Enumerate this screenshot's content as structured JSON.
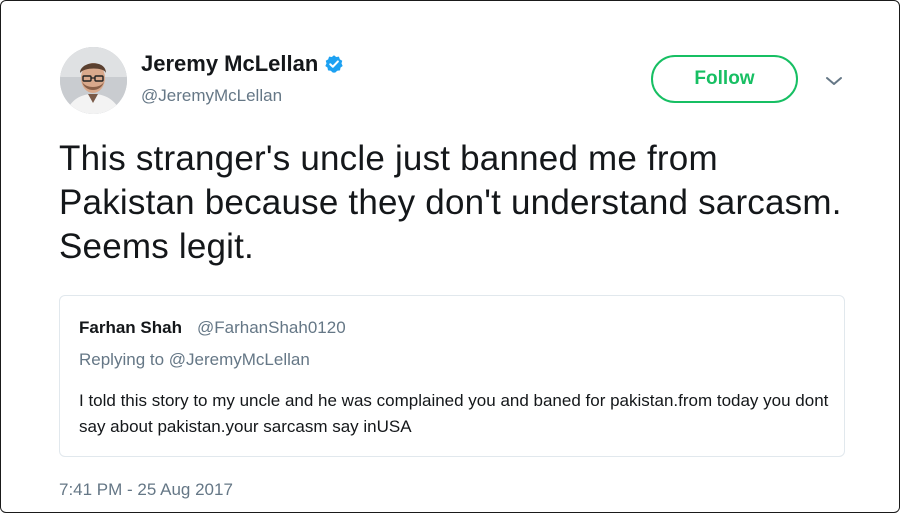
{
  "tweet": {
    "author": {
      "name": "Jeremy McLellan",
      "handle": "@JeremyMcLellan",
      "verified_icon": "verified-badge-icon",
      "avatar_icon": "profile-photo"
    },
    "follow_label": "Follow",
    "menu_icon": "chevron-down-icon",
    "text": "This stranger's uncle just banned me from Pakistan because they don't understand sarcasm. Seems legit.",
    "timestamp": "7:41 PM - 25 Aug 2017"
  },
  "quoted_tweet": {
    "name": "Farhan Shah",
    "handle": "@FarhanShah0120",
    "replying_to": "Replying to @JeremyMcLellan",
    "text": "I told this story to my uncle and he was complained you and baned for pakistan.from today you dont say about pakistan.your sarcasm say inUSA"
  },
  "colors": {
    "follow_green": "#17bf63",
    "verified_blue": "#1da1f2",
    "muted_text": "#657786",
    "border": "#e1e8ed"
  }
}
